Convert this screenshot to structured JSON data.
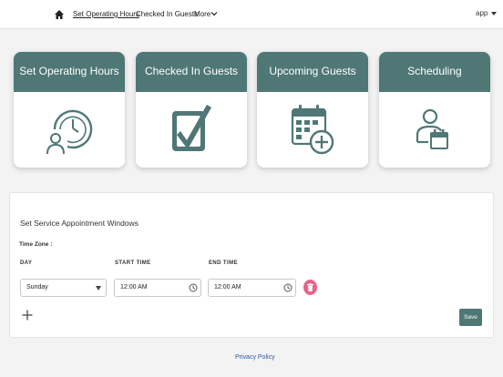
{
  "nav": {
    "home_icon": "home-icon",
    "links": [
      "Set Operating Hours",
      "Checked In Guests",
      "More"
    ],
    "app_label": "app"
  },
  "tiles": [
    {
      "title": "Set Operating Hours",
      "icon": "clock-person-icon"
    },
    {
      "title": "Checked In Guests",
      "icon": "checkbox-icon"
    },
    {
      "title": "Upcoming Guests",
      "icon": "calendar-add-icon"
    },
    {
      "title": "Scheduling",
      "icon": "person-calendar-icon"
    }
  ],
  "form": {
    "title": "Set Service Appointment Windows",
    "timezone_label": "Time Zone :",
    "columns": [
      "DAY",
      "START TIME",
      "END TIME"
    ],
    "row": {
      "day": "Sunday",
      "start_time": "12:00 AM",
      "end_time": "12:00 AM"
    },
    "save_label": "Save"
  },
  "footer": {
    "privacy_label": "Privacy Policy"
  },
  "colors": {
    "accent": "#4f7776",
    "delete": "#e8638c",
    "link": "#2d5a9e"
  }
}
